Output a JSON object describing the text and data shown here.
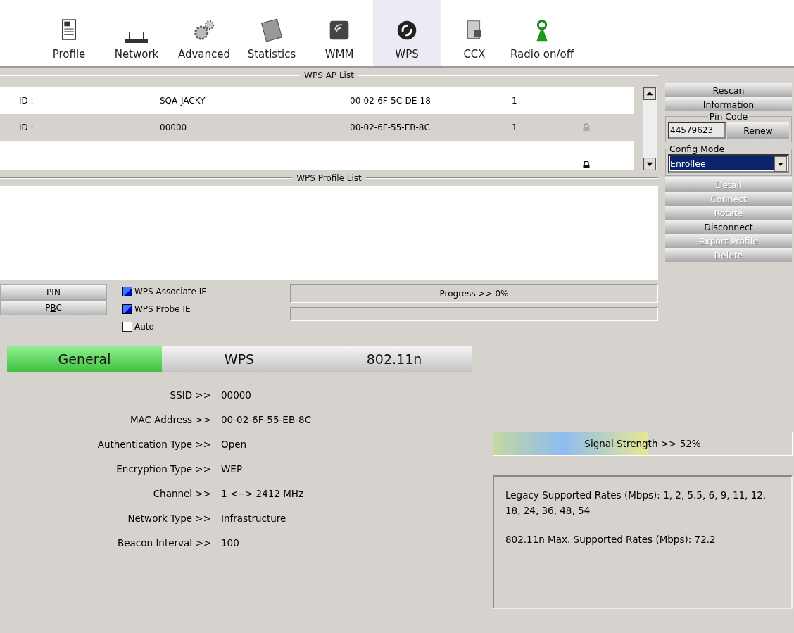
{
  "toolbar": [
    {
      "label": "Profile",
      "selected": false
    },
    {
      "label": "Network",
      "selected": false
    },
    {
      "label": "Advanced",
      "selected": false
    },
    {
      "label": "Statistics",
      "selected": false
    },
    {
      "label": "WMM",
      "selected": false
    },
    {
      "label": "WPS",
      "selected": true
    },
    {
      "label": "CCX",
      "selected": false
    },
    {
      "label": "Radio on/off",
      "selected": false
    }
  ],
  "ap_list": {
    "title": "WPS AP List",
    "rows": [
      {
        "id": "ID :",
        "ssid": "SQA-JACKY",
        "mac": "00-02-6F-5C-DE-18",
        "channel": "1",
        "locked": false,
        "selected": false
      },
      {
        "id": "ID :",
        "ssid": "00000",
        "mac": "00-02-6F-55-EB-8C",
        "channel": "1",
        "locked": true,
        "selected": true
      },
      {
        "locked": true,
        "selected": false
      }
    ]
  },
  "profile_list": {
    "title": "WPS Profile List"
  },
  "side_buttons_top": [
    {
      "label": "Rescan",
      "disabled": false
    },
    {
      "label": "Information",
      "disabled": false
    }
  ],
  "pin_code": {
    "title": "Pin Code",
    "value": "44579623",
    "button": "Renew"
  },
  "config_mode": {
    "title": "Config Mode",
    "value": "Enrollee"
  },
  "side_buttons": [
    {
      "label": "Detail",
      "disabled": true
    },
    {
      "label": "Connect",
      "disabled": true
    },
    {
      "label": "Rotate",
      "disabled": true
    },
    {
      "label": "Disconnect",
      "disabled": false
    },
    {
      "label": "Export Profile",
      "disabled": true
    },
    {
      "label": "Delete",
      "disabled": true
    }
  ],
  "method_buttons": [
    {
      "label": "PIN"
    },
    {
      "label": "PBC"
    }
  ],
  "options": [
    {
      "label": "WPS Associate IE",
      "checked": true
    },
    {
      "label": "WPS Probe IE",
      "checked": true
    },
    {
      "label": "Auto",
      "checked": false
    }
  ],
  "progress": [
    {
      "text": "Progress >> 0%",
      "level": 0
    },
    {
      "level": 0
    }
  ],
  "tabs": [
    {
      "label": "General",
      "selected": true
    },
    {
      "label": "WPS",
      "selected": false
    },
    {
      "label": "802.11n",
      "selected": false
    }
  ],
  "details": [
    {
      "label": "SSID >>",
      "value": "00000"
    },
    {
      "label": "MAC Address >>",
      "value": "00-02-6F-55-EB-8C"
    },
    {
      "label": "Authentication Type >>",
      "value": "Open"
    },
    {
      "label": "Encryption Type >>",
      "value": "WEP"
    },
    {
      "label": "Channel >>",
      "value": "1 <--> 2412 MHz"
    },
    {
      "label": "Network Type >>",
      "value": "Infrastructure"
    },
    {
      "label": "Beacon Interval >>",
      "value": "100"
    }
  ],
  "signal": {
    "text": "Signal Strength >> 52%",
    "level": 0.52
  },
  "rates": [
    "Legacy Supported Rates (Mbps): 1, 2, 5.5, 6, 9, 11, 12, 18, 24, 36, 48, 54",
    "802.11n Max. Supported Rates (Mbps): 72.2"
  ]
}
